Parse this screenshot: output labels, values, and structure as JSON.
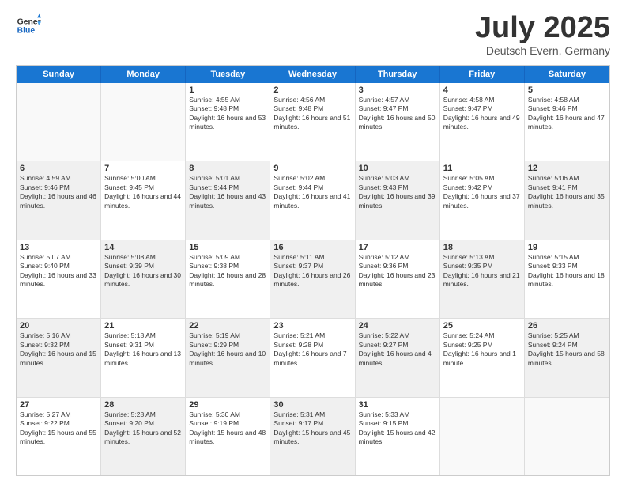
{
  "header": {
    "logo_general": "General",
    "logo_blue": "Blue",
    "month_title": "July 2025",
    "location": "Deutsch Evern, Germany"
  },
  "weekdays": [
    "Sunday",
    "Monday",
    "Tuesday",
    "Wednesday",
    "Thursday",
    "Friday",
    "Saturday"
  ],
  "rows": [
    [
      {
        "day": "",
        "empty": true
      },
      {
        "day": "",
        "empty": true
      },
      {
        "day": "1",
        "sunrise": "Sunrise: 4:55 AM",
        "sunset": "Sunset: 9:48 PM",
        "daylight": "Daylight: 16 hours and 53 minutes."
      },
      {
        "day": "2",
        "sunrise": "Sunrise: 4:56 AM",
        "sunset": "Sunset: 9:48 PM",
        "daylight": "Daylight: 16 hours and 51 minutes."
      },
      {
        "day": "3",
        "sunrise": "Sunrise: 4:57 AM",
        "sunset": "Sunset: 9:47 PM",
        "daylight": "Daylight: 16 hours and 50 minutes."
      },
      {
        "day": "4",
        "sunrise": "Sunrise: 4:58 AM",
        "sunset": "Sunset: 9:47 PM",
        "daylight": "Daylight: 16 hours and 49 minutes."
      },
      {
        "day": "5",
        "sunrise": "Sunrise: 4:58 AM",
        "sunset": "Sunset: 9:46 PM",
        "daylight": "Daylight: 16 hours and 47 minutes."
      }
    ],
    [
      {
        "day": "6",
        "sunrise": "Sunrise: 4:59 AM",
        "sunset": "Sunset: 9:46 PM",
        "daylight": "Daylight: 16 hours and 46 minutes.",
        "shaded": true
      },
      {
        "day": "7",
        "sunrise": "Sunrise: 5:00 AM",
        "sunset": "Sunset: 9:45 PM",
        "daylight": "Daylight: 16 hours and 44 minutes."
      },
      {
        "day": "8",
        "sunrise": "Sunrise: 5:01 AM",
        "sunset": "Sunset: 9:44 PM",
        "daylight": "Daylight: 16 hours and 43 minutes.",
        "shaded": true
      },
      {
        "day": "9",
        "sunrise": "Sunrise: 5:02 AM",
        "sunset": "Sunset: 9:44 PM",
        "daylight": "Daylight: 16 hours and 41 minutes."
      },
      {
        "day": "10",
        "sunrise": "Sunrise: 5:03 AM",
        "sunset": "Sunset: 9:43 PM",
        "daylight": "Daylight: 16 hours and 39 minutes.",
        "shaded": true
      },
      {
        "day": "11",
        "sunrise": "Sunrise: 5:05 AM",
        "sunset": "Sunset: 9:42 PM",
        "daylight": "Daylight: 16 hours and 37 minutes."
      },
      {
        "day": "12",
        "sunrise": "Sunrise: 5:06 AM",
        "sunset": "Sunset: 9:41 PM",
        "daylight": "Daylight: 16 hours and 35 minutes.",
        "shaded": true
      }
    ],
    [
      {
        "day": "13",
        "sunrise": "Sunrise: 5:07 AM",
        "sunset": "Sunset: 9:40 PM",
        "daylight": "Daylight: 16 hours and 33 minutes."
      },
      {
        "day": "14",
        "sunrise": "Sunrise: 5:08 AM",
        "sunset": "Sunset: 9:39 PM",
        "daylight": "Daylight: 16 hours and 30 minutes.",
        "shaded": true
      },
      {
        "day": "15",
        "sunrise": "Sunrise: 5:09 AM",
        "sunset": "Sunset: 9:38 PM",
        "daylight": "Daylight: 16 hours and 28 minutes."
      },
      {
        "day": "16",
        "sunrise": "Sunrise: 5:11 AM",
        "sunset": "Sunset: 9:37 PM",
        "daylight": "Daylight: 16 hours and 26 minutes.",
        "shaded": true
      },
      {
        "day": "17",
        "sunrise": "Sunrise: 5:12 AM",
        "sunset": "Sunset: 9:36 PM",
        "daylight": "Daylight: 16 hours and 23 minutes."
      },
      {
        "day": "18",
        "sunrise": "Sunrise: 5:13 AM",
        "sunset": "Sunset: 9:35 PM",
        "daylight": "Daylight: 16 hours and 21 minutes.",
        "shaded": true
      },
      {
        "day": "19",
        "sunrise": "Sunrise: 5:15 AM",
        "sunset": "Sunset: 9:33 PM",
        "daylight": "Daylight: 16 hours and 18 minutes."
      }
    ],
    [
      {
        "day": "20",
        "sunrise": "Sunrise: 5:16 AM",
        "sunset": "Sunset: 9:32 PM",
        "daylight": "Daylight: 16 hours and 15 minutes.",
        "shaded": true
      },
      {
        "day": "21",
        "sunrise": "Sunrise: 5:18 AM",
        "sunset": "Sunset: 9:31 PM",
        "daylight": "Daylight: 16 hours and 13 minutes."
      },
      {
        "day": "22",
        "sunrise": "Sunrise: 5:19 AM",
        "sunset": "Sunset: 9:29 PM",
        "daylight": "Daylight: 16 hours and 10 minutes.",
        "shaded": true
      },
      {
        "day": "23",
        "sunrise": "Sunrise: 5:21 AM",
        "sunset": "Sunset: 9:28 PM",
        "daylight": "Daylight: 16 hours and 7 minutes."
      },
      {
        "day": "24",
        "sunrise": "Sunrise: 5:22 AM",
        "sunset": "Sunset: 9:27 PM",
        "daylight": "Daylight: 16 hours and 4 minutes.",
        "shaded": true
      },
      {
        "day": "25",
        "sunrise": "Sunrise: 5:24 AM",
        "sunset": "Sunset: 9:25 PM",
        "daylight": "Daylight: 16 hours and 1 minute."
      },
      {
        "day": "26",
        "sunrise": "Sunrise: 5:25 AM",
        "sunset": "Sunset: 9:24 PM",
        "daylight": "Daylight: 15 hours and 58 minutes.",
        "shaded": true
      }
    ],
    [
      {
        "day": "27",
        "sunrise": "Sunrise: 5:27 AM",
        "sunset": "Sunset: 9:22 PM",
        "daylight": "Daylight: 15 hours and 55 minutes."
      },
      {
        "day": "28",
        "sunrise": "Sunrise: 5:28 AM",
        "sunset": "Sunset: 9:20 PM",
        "daylight": "Daylight: 15 hours and 52 minutes.",
        "shaded": true
      },
      {
        "day": "29",
        "sunrise": "Sunrise: 5:30 AM",
        "sunset": "Sunset: 9:19 PM",
        "daylight": "Daylight: 15 hours and 48 minutes."
      },
      {
        "day": "30",
        "sunrise": "Sunrise: 5:31 AM",
        "sunset": "Sunset: 9:17 PM",
        "daylight": "Daylight: 15 hours and 45 minutes.",
        "shaded": true
      },
      {
        "day": "31",
        "sunrise": "Sunrise: 5:33 AM",
        "sunset": "Sunset: 9:15 PM",
        "daylight": "Daylight: 15 hours and 42 minutes."
      },
      {
        "day": "",
        "empty": true
      },
      {
        "day": "",
        "empty": true
      }
    ]
  ]
}
